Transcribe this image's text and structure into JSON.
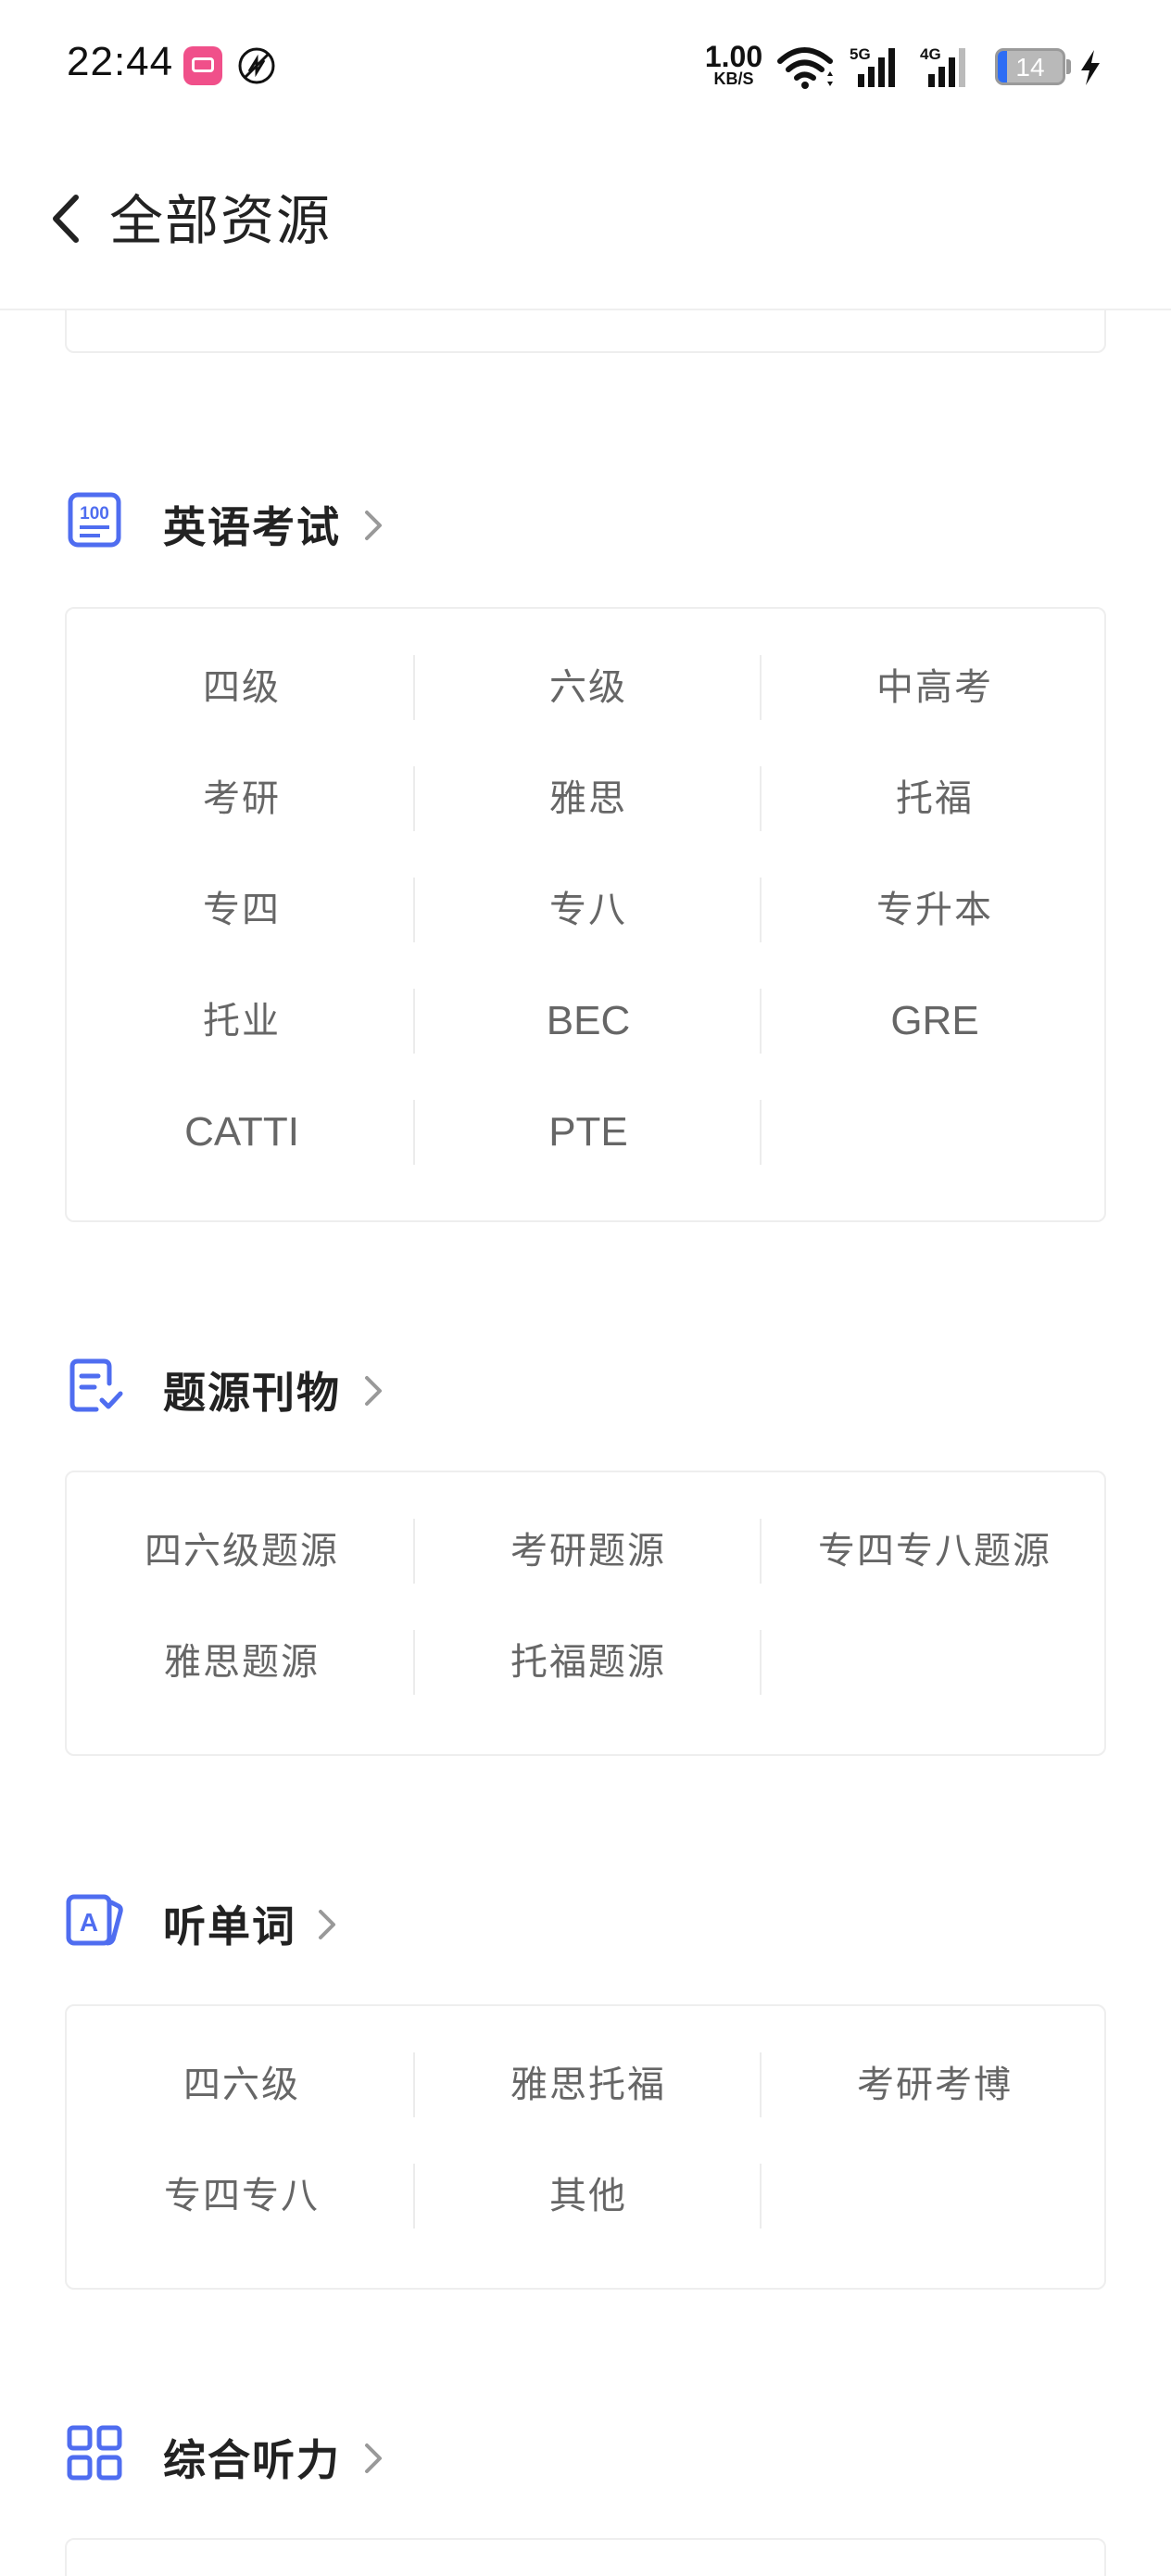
{
  "status_bar": {
    "time": "22:44",
    "net_speed_value": "1.00",
    "net_speed_unit": "KB/S",
    "sig1_label": "5G",
    "sig2_label": "4G",
    "battery_level": "14"
  },
  "header": {
    "title": "全部资源"
  },
  "sections": [
    {
      "title": "英语考试",
      "icon": "score-100-icon",
      "items": [
        "四级",
        "六级",
        "中高考",
        "考研",
        "雅思",
        "托福",
        "专四",
        "专八",
        "专升本",
        "托业",
        "BEC",
        "GRE",
        "CATTI",
        "PTE"
      ]
    },
    {
      "title": "题源刊物",
      "icon": "document-check-icon",
      "items": [
        "四六级题源",
        "考研题源",
        "专四专八题源",
        "雅思题源",
        "托福题源"
      ]
    },
    {
      "title": "听单词",
      "icon": "letter-card-icon",
      "items": [
        "四六级",
        "雅思托福",
        "考研考博",
        "专四专八",
        "其他"
      ]
    },
    {
      "title": "综合听力",
      "icon": "grid-icon",
      "items": []
    }
  ],
  "colors": {
    "accent_icon": "#4f6df0",
    "divider": "#ececec"
  }
}
